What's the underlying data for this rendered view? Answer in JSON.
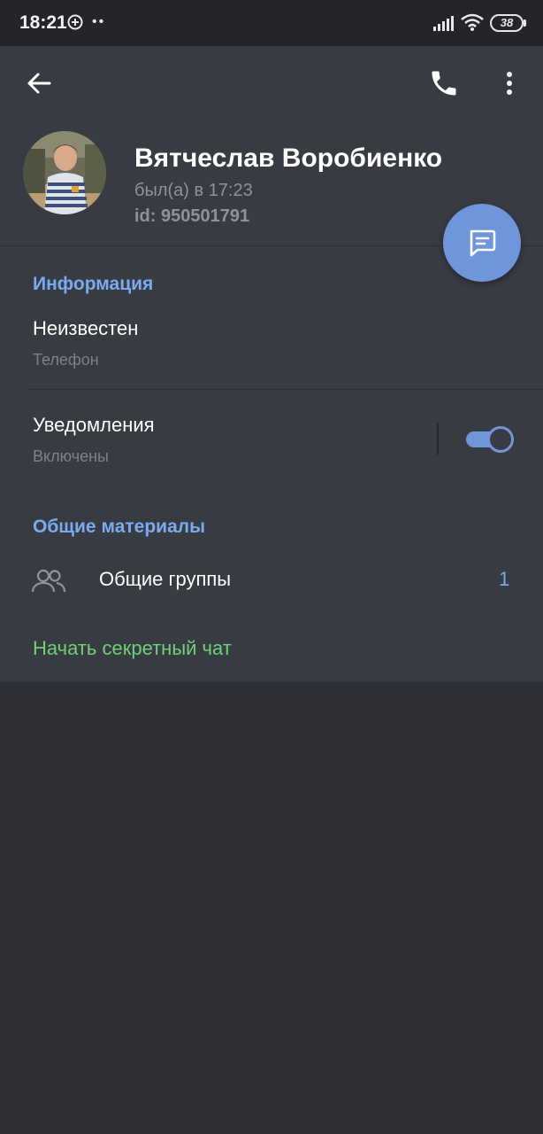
{
  "status_bar": {
    "time": "18:21",
    "dots": "••",
    "battery": "38",
    "icons": [
      "messenger-plus-icon",
      "signal-icon",
      "wifi-icon",
      "battery-icon"
    ]
  },
  "header": {
    "icons": [
      "back-arrow-icon",
      "phone-icon",
      "more-vertical-icon"
    ],
    "name": "Вятчеслав Воробиенко",
    "last_seen": "был(а) в 17:23",
    "user_id": "id: 950501791",
    "fab_icon": "message-icon"
  },
  "info": {
    "section_title": "Информация",
    "phone_value": "Неизвестен",
    "phone_label": "Телефон",
    "notifications_title": "Уведомления",
    "notifications_status": "Включены",
    "notifications_enabled": true
  },
  "shared": {
    "section_title": "Общие материалы",
    "groups_label": "Общие группы",
    "groups_count": "1",
    "groups_icon": "users-icon"
  },
  "secret_chat": "Начать секретный чат",
  "colors": {
    "accent": "#6f95db",
    "section_title": "#7aaaf0",
    "secret_chat": "#6fd178",
    "panel": "#393b43",
    "background": "#2f3035"
  }
}
